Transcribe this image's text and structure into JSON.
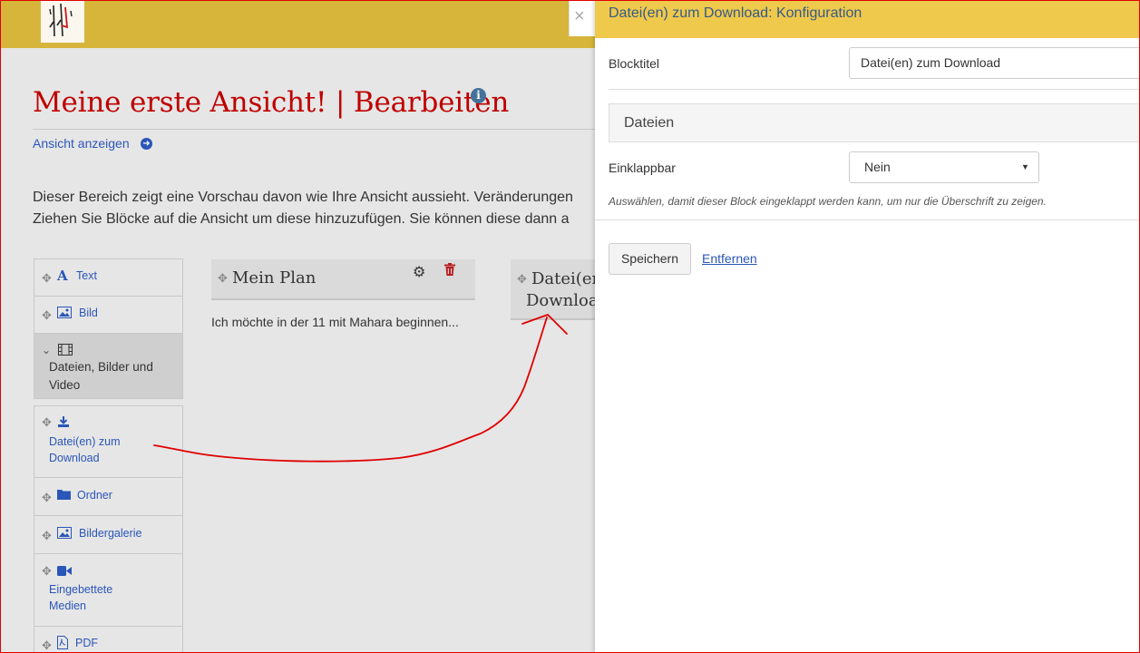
{
  "header": {
    "logo_icon": "mahara-logo-icon"
  },
  "page": {
    "title": "Meine erste Ansicht! | Bearbeiten",
    "info_icon": "info-icon",
    "view_link": "Ansicht anzeigen",
    "view_link_icon": "arrow-circle-right-icon",
    "intro_line1": "Dieser Bereich zeigt eine Vorschau davon wie Ihre Ansicht aussieht. Veränderungen",
    "intro_line2": "Ziehen Sie Blöcke auf die Ansicht um diese hinzuzufügen. Sie können diese dann a"
  },
  "palette": {
    "items": [
      {
        "label": "Text",
        "icon": "font-icon"
      },
      {
        "label": "Bild",
        "icon": "image-icon"
      },
      {
        "label": "Dateien, Bilder und Video",
        "icon": "film-icon",
        "expanded": true
      },
      {
        "label": "Datei(en) zum Download",
        "icon": "download-icon"
      },
      {
        "label": "Ordner",
        "icon": "folder-icon"
      },
      {
        "label": "Bildergalerie",
        "icon": "images-icon"
      },
      {
        "label": "Eingebettete Medien",
        "icon": "video-camera-icon"
      },
      {
        "label": "PDF",
        "icon": "pdf-file-icon"
      }
    ]
  },
  "blocks": {
    "block1": {
      "title": "Mein Plan",
      "body": "Ich möchte in der 11 mit Mahara beginnen..."
    },
    "block2": {
      "title_line1": "Datei(en",
      "title_line2": "Download"
    }
  },
  "modal": {
    "close": "×",
    "title": "Datei(en) zum Download: Konfiguration",
    "block_title_label": "Blocktitel",
    "block_title_value": "Datei(en) zum Download",
    "section_label": "Dateien",
    "collapsible_label": "Einklappbar",
    "collapsible_value": "Nein",
    "collapsible_help": "Auswählen, damit dieser Block eingeklappt werden kann, um nur die Überschrift zu zeigen.",
    "save_button": "Speichern",
    "remove_link": "Entfernen"
  },
  "colors": {
    "header_bar": "#d6b53a",
    "modal_header": "#efc94b",
    "title_red": "#c00000",
    "link_blue": "#2a56b8",
    "annotation_red": "#e00000"
  }
}
